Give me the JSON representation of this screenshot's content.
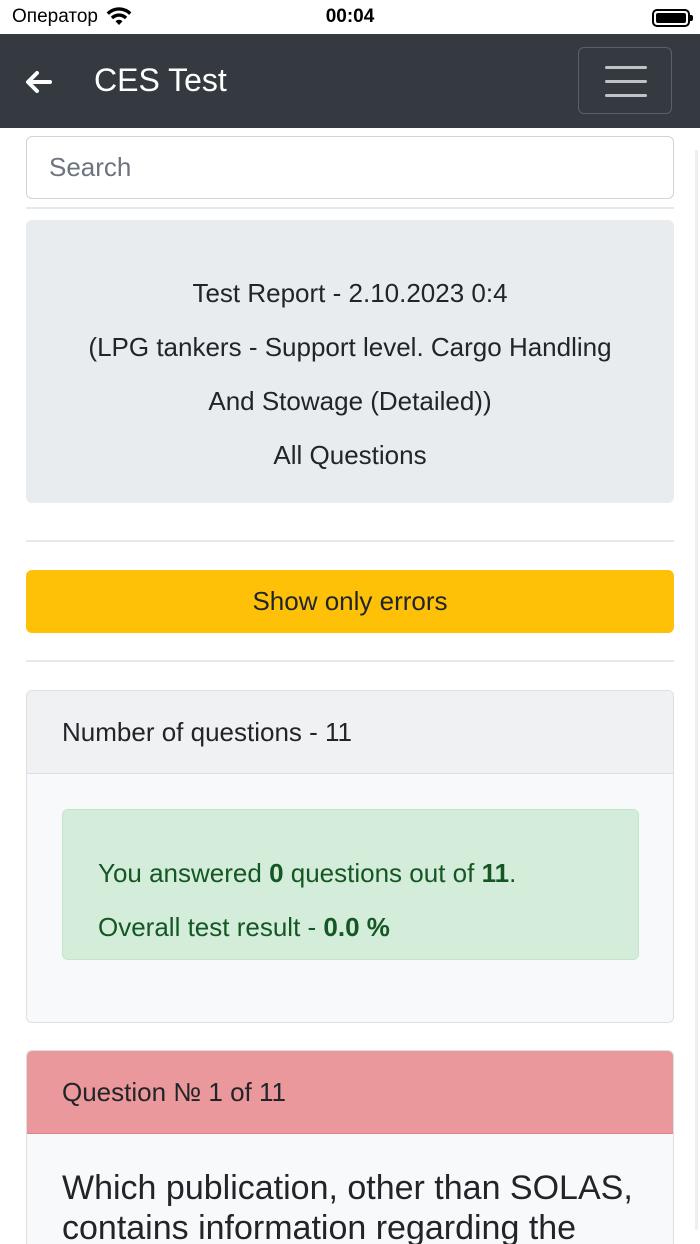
{
  "status_bar": {
    "carrier": "Оператор",
    "time": "00:04"
  },
  "header": {
    "title": "CES Test",
    "back_icon": "arrow-left-icon",
    "menu_icon": "hamburger-menu-icon"
  },
  "search": {
    "placeholder": "Search"
  },
  "report": {
    "line1": "Test Report - 2.10.2023 0:4",
    "line2": "(LPG tankers - Support level. Cargo Handling",
    "line3": "And Stowage (Detailed))",
    "line4": "All Questions"
  },
  "filter_button": {
    "label": "Show only errors"
  },
  "summary": {
    "header": "Number of questions - 11",
    "answered_prefix": "You answered ",
    "answered_count": "0",
    "answered_middle": " questions out of ",
    "total": "11",
    "answered_suffix": ".",
    "result_prefix": "Overall test result - ",
    "result_value": "0.0 %"
  },
  "question": {
    "header": "Question № 1 of 11",
    "text": "Which publication, other than SOLAS, contains information regarding the"
  },
  "colors": {
    "navbar": "#343a40",
    "warning": "#ffc107",
    "success_bg": "#d4edda",
    "success_text": "#155724",
    "danger_header": "#ea989c"
  }
}
